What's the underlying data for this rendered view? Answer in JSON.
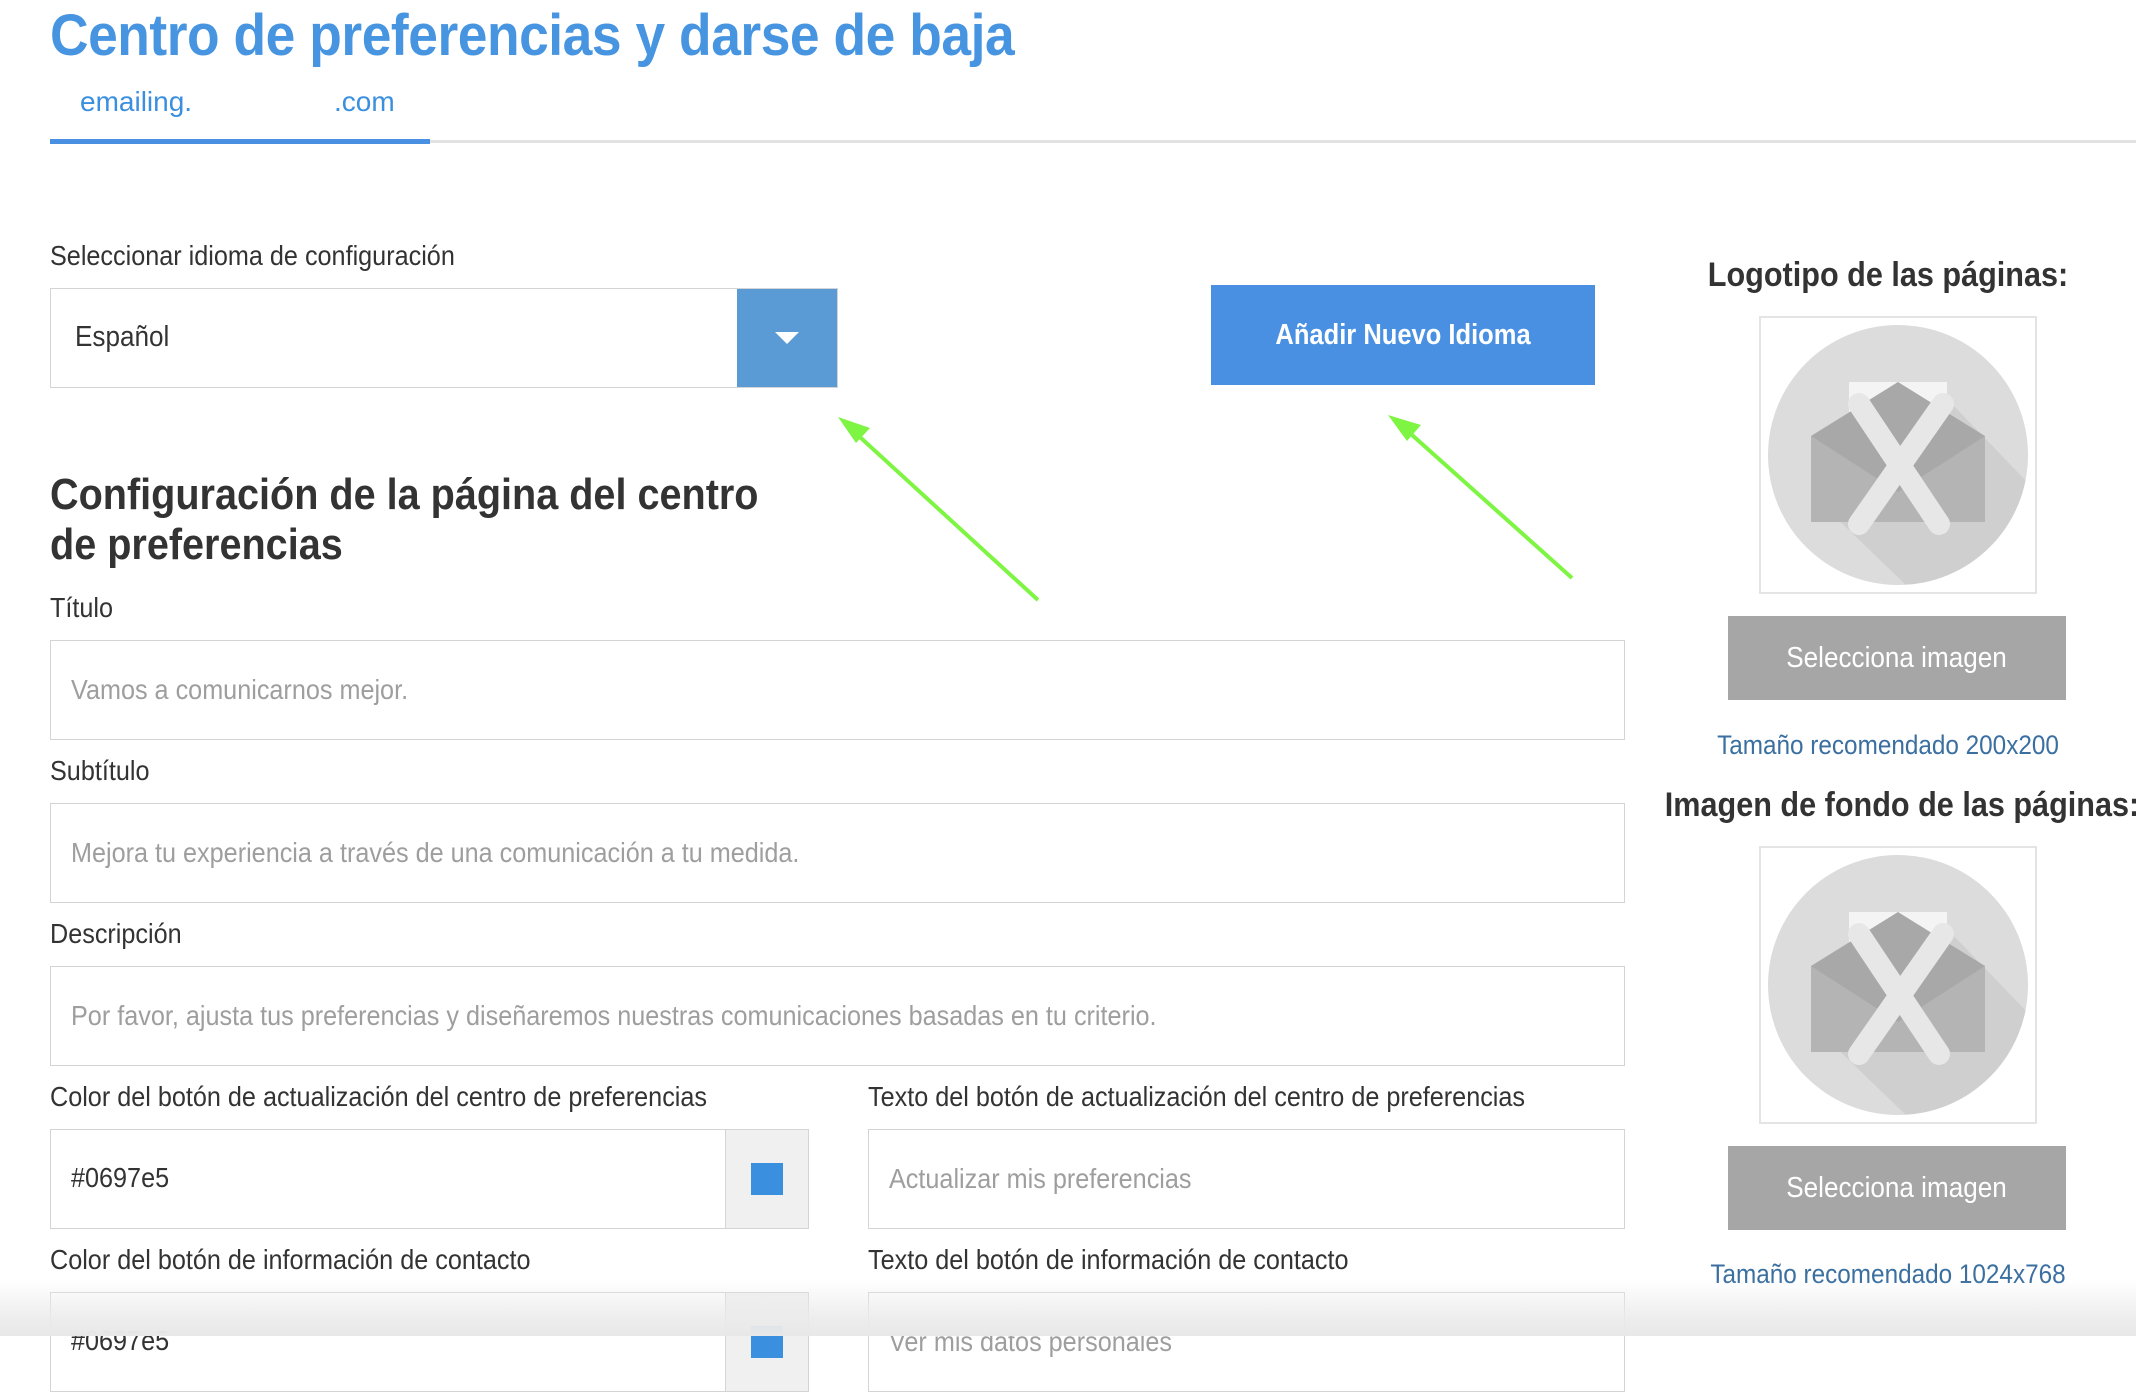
{
  "header": {
    "title": "Centro de preferencias y darse de baja",
    "tab_left": "emailing.",
    "tab_right": ".com"
  },
  "language": {
    "label": "Seleccionar idioma de configuración",
    "selected": "Español",
    "add_button": "Añadir Nuevo Idioma"
  },
  "section": {
    "title": "Configuración de la página del centro de preferencias"
  },
  "fields": {
    "titulo": {
      "label": "Título",
      "placeholder": "Vamos a comunicarnos mejor."
    },
    "subtitulo": {
      "label": "Subtítulo",
      "placeholder": "Mejora tu experiencia a través de una comunicación a tu medida."
    },
    "descripcion": {
      "label": "Descripción",
      "placeholder": "Por favor, ajusta tus preferencias y diseñaremos nuestras comunicaciones basadas en tu criterio."
    },
    "update_color": {
      "label": "Color del botón de actualización del centro de preferencias",
      "value": "#0697e5"
    },
    "update_text": {
      "label": "Texto del botón de actualización del centro de preferencias",
      "placeholder": "Actualizar mis preferencias"
    },
    "contact_color": {
      "label": "Color del botón de información de contacto",
      "value": "#0697e5"
    },
    "contact_text": {
      "label": "Texto del botón de información de contacto",
      "placeholder": "Ver mis datos personales"
    }
  },
  "sidebar": {
    "logo": {
      "title": "Logotipo de las páginas:",
      "button": "Selecciona imagen",
      "recommended": "Tamaño recomendado 200x200",
      "icon": "no-image-icon"
    },
    "background": {
      "title": "Imagen de fondo de las páginas:",
      "button": "Selecciona imagen",
      "recommended": "Tamaño recomendado 1024x768",
      "icon": "no-image-icon"
    }
  },
  "colors": {
    "title": "#4795e0",
    "primary_button": "#4a90e2",
    "select_arrow": "#5b9bd5",
    "gray_button": "#a6a6a6",
    "swatch": "#3a8fde",
    "annotation_arrow": "#7ef542"
  }
}
